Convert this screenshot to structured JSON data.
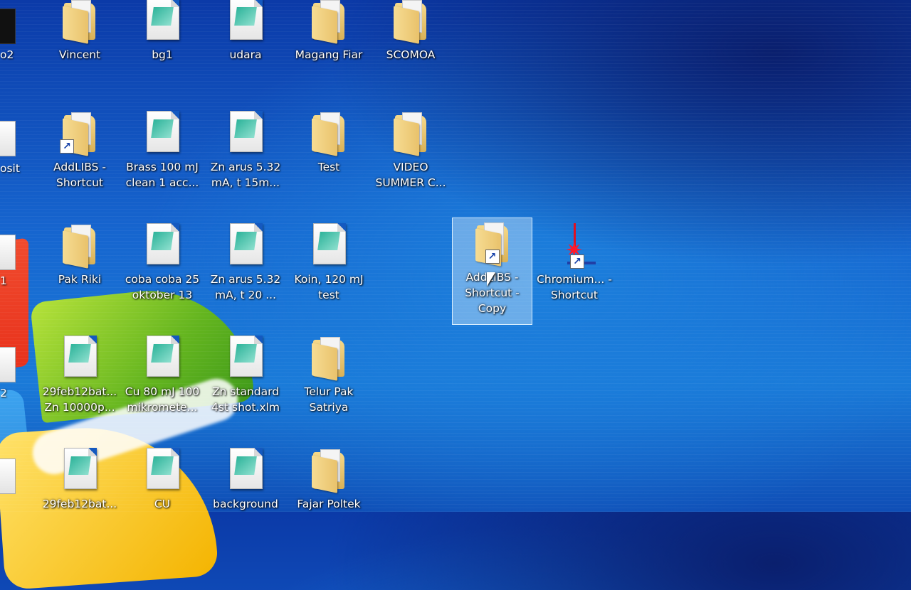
{
  "desktop": {
    "icons": [
      {
        "label": "Vincent",
        "type": "folder"
      },
      {
        "label": "bg1",
        "type": "file"
      },
      {
        "label": "udara",
        "type": "file"
      },
      {
        "label": "Magang Fiar",
        "type": "folder"
      },
      {
        "label": "SCOMOA",
        "type": "folder"
      },
      {
        "label": "AddLIBS - Shortcut",
        "type": "folder-shortcut"
      },
      {
        "label": "Brass 100 mJ clean 1 acc...",
        "type": "file"
      },
      {
        "label": "Zn arus 5.32 mA, t 15m...",
        "type": "file"
      },
      {
        "label": "Test",
        "type": "folder"
      },
      {
        "label": "VIDEO SUMMER C...",
        "type": "folder"
      },
      {
        "label": "Pak Riki",
        "type": "folder"
      },
      {
        "label": "coba coba 25 oktober 13",
        "type": "file"
      },
      {
        "label": "Zn arus 5.32 mA, t 20 ...",
        "type": "file"
      },
      {
        "label": "Koin, 120 mJ test",
        "type": "file"
      },
      {
        "label": "AddLIBS - Shortcut - Copy",
        "type": "folder-shortcut",
        "selected": true
      },
      {
        "label": "Chromium... - Shortcut",
        "type": "app-shortcut"
      },
      {
        "label": "29feb12bat... Zn 10000p...",
        "type": "file"
      },
      {
        "label": "Cu 80 mJ 100 mikromete...",
        "type": "file"
      },
      {
        "label": "Zn standard 4st shot.xlm",
        "type": "file"
      },
      {
        "label": "Telur Pak Satriya",
        "type": "folder"
      },
      {
        "label": "29feb12bat...",
        "type": "file"
      },
      {
        "label": "CU",
        "type": "file"
      },
      {
        "label": "background",
        "type": "file"
      },
      {
        "label": "Fajar Poltek",
        "type": "folder"
      }
    ],
    "partial_labels": [
      "o2",
      "osit",
      "1",
      "2"
    ],
    "shortcut_arrow": "↗",
    "laser_star": "✷"
  }
}
